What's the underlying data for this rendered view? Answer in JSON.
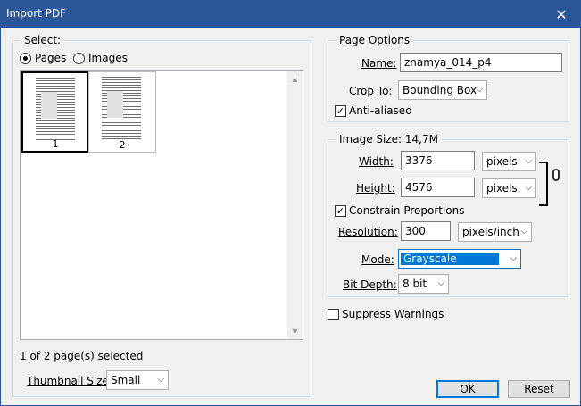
{
  "window": {
    "title": "Import PDF",
    "close_glyph": "✕"
  },
  "select_group": {
    "legend": "Select:",
    "radio_pages": "Pages",
    "radio_images": "Images",
    "selected_mode": "Pages",
    "thumbnails": [
      {
        "label": "1",
        "selected": true
      },
      {
        "label": "2",
        "selected": false
      }
    ],
    "status": "1 of 2 page(s) selected",
    "thumbnail_size_label": "Thumbnail Size:",
    "thumbnail_size_value": "Small"
  },
  "page_options": {
    "legend": "Page Options",
    "name_label": "Name:",
    "name_value": "znamya_014_p4",
    "crop_label": "Crop To:",
    "crop_value": "Bounding Box",
    "antialiased_label": "Anti-aliased",
    "antialiased_checked": true
  },
  "image_size": {
    "legend": "Image Size: 14,7M",
    "width_label": "Width:",
    "width_value": "3376",
    "width_unit": "pixels",
    "height_label": "Height:",
    "height_value": "4576",
    "height_unit": "pixels",
    "constrain_label": "Constrain Proportions",
    "constrain_checked": true,
    "resolution_label": "Resolution:",
    "resolution_value": "300",
    "resolution_unit": "pixels/inch",
    "mode_label": "Mode:",
    "mode_value": "Grayscale",
    "bitdepth_label": "Bit Depth:",
    "bitdepth_value": "8 bit"
  },
  "suppress_warnings_label": "Suppress Warnings",
  "suppress_warnings_checked": false,
  "buttons": {
    "ok": "OK",
    "reset": "Reset"
  },
  "icons": {
    "check": "✓",
    "chevron": "⌵",
    "up": "▲",
    "down": "▼"
  },
  "colors": {
    "titlebar": "#2b579a",
    "accent": "#0078d7"
  }
}
